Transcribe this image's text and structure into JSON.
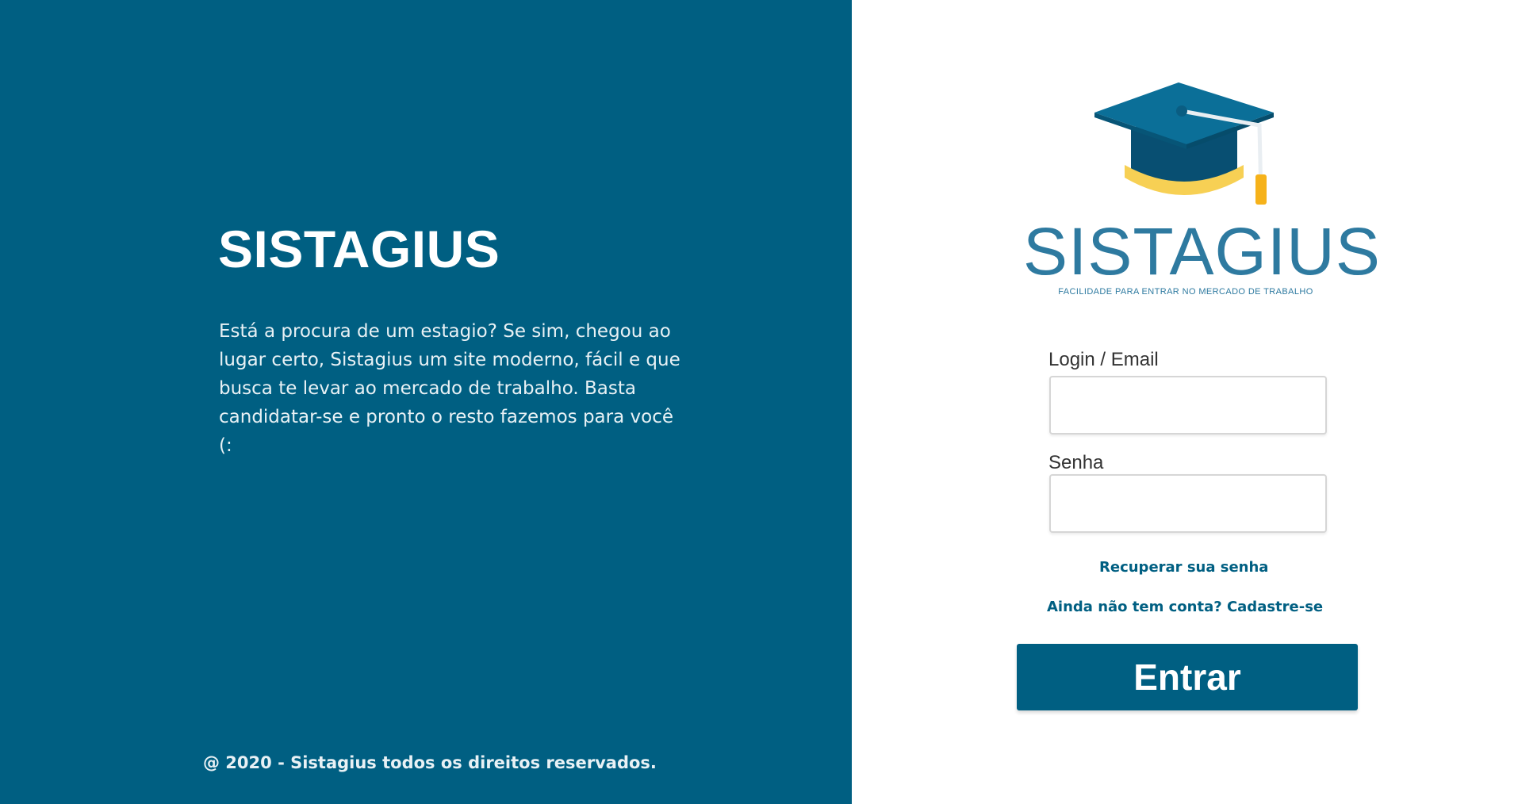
{
  "colors": {
    "brand_blue": "#005f82",
    "logo_blue": "#2e7aa0",
    "cap_blue": "#0b6f98",
    "tassel_gold": "#f6b21a",
    "white": "#ffffff"
  },
  "hero": {
    "title": "SISTAGIUS",
    "description": "Está a procura de um estagio? Se sim, chegou ao lugar certo, Sistagius um site moderno, fácil e que busca te levar ao mercado de trabalho. Basta candidatar-se e pronto o resto fazemos para você (:",
    "footer": "@ 2020 - Sistagius todos os direitos reservados."
  },
  "logo": {
    "icon": "graduation-cap-icon",
    "wordmark": "SISTAGIUS",
    "tagline": "FACILIDADE PARA ENTRAR NO MERCADO DE TRABALHO"
  },
  "form": {
    "login_label": "Login / Email",
    "login_value": "",
    "password_label": "Senha",
    "password_value": "",
    "recover_link": "Recuperar sua senha",
    "signup_link": "Ainda não tem conta? Cadastre-se",
    "submit_label": "Entrar"
  }
}
